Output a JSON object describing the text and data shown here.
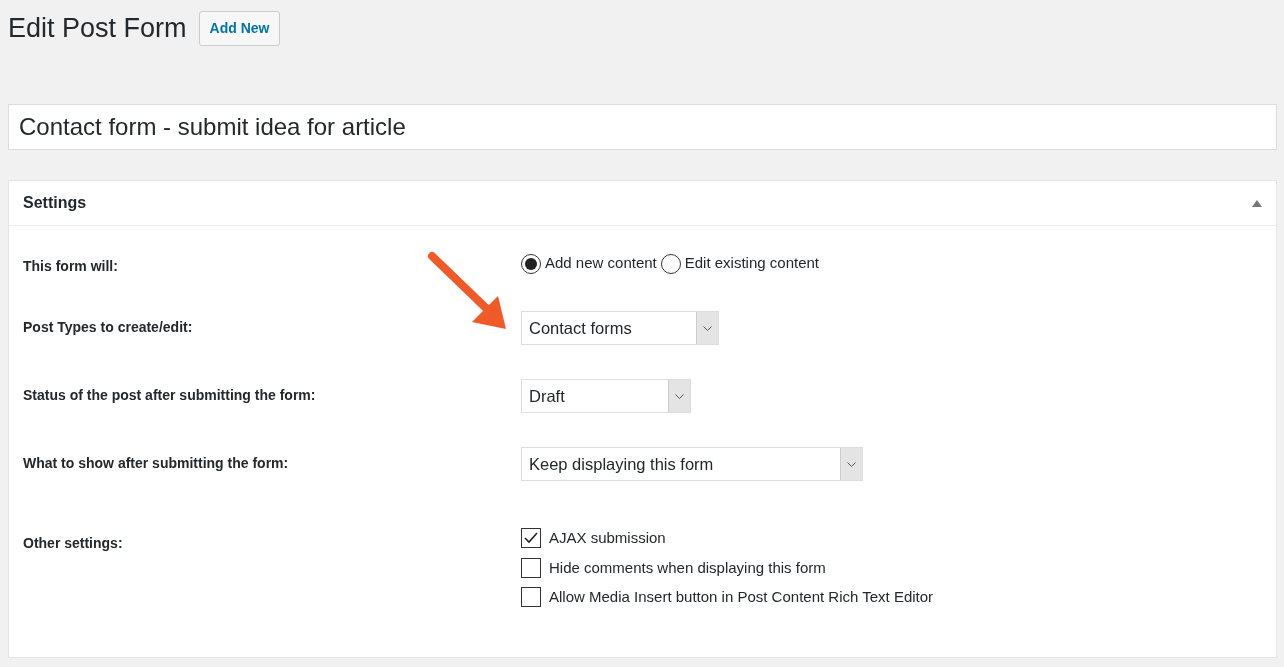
{
  "page": {
    "title": "Edit Post Form",
    "add_new": "Add New"
  },
  "post_title": {
    "value": "Contact form - submit idea for article"
  },
  "settings": {
    "title": "Settings",
    "expanded": true,
    "rows": [
      {
        "kind": "radio",
        "label": "This form will:",
        "options": [
          {
            "label": "Add new content",
            "selected": true
          },
          {
            "label": "Edit existing content",
            "selected": false
          }
        ]
      },
      {
        "kind": "select",
        "label": "Post Types to create/edit:",
        "value": "Contact forms"
      },
      {
        "kind": "select",
        "label": "Status of the post after submitting the form:",
        "value": "Draft"
      },
      {
        "kind": "select",
        "label": "What to show after submitting the form:",
        "value": "Keep displaying this form"
      },
      {
        "kind": "checkboxes",
        "label": "Other settings:",
        "options": [
          {
            "label": "AJAX submission",
            "checked": true
          },
          {
            "label": "Hide comments when displaying this form",
            "checked": false
          },
          {
            "label": "Allow Media Insert button in Post Content Rich Text Editor",
            "checked": false
          }
        ]
      }
    ]
  }
}
